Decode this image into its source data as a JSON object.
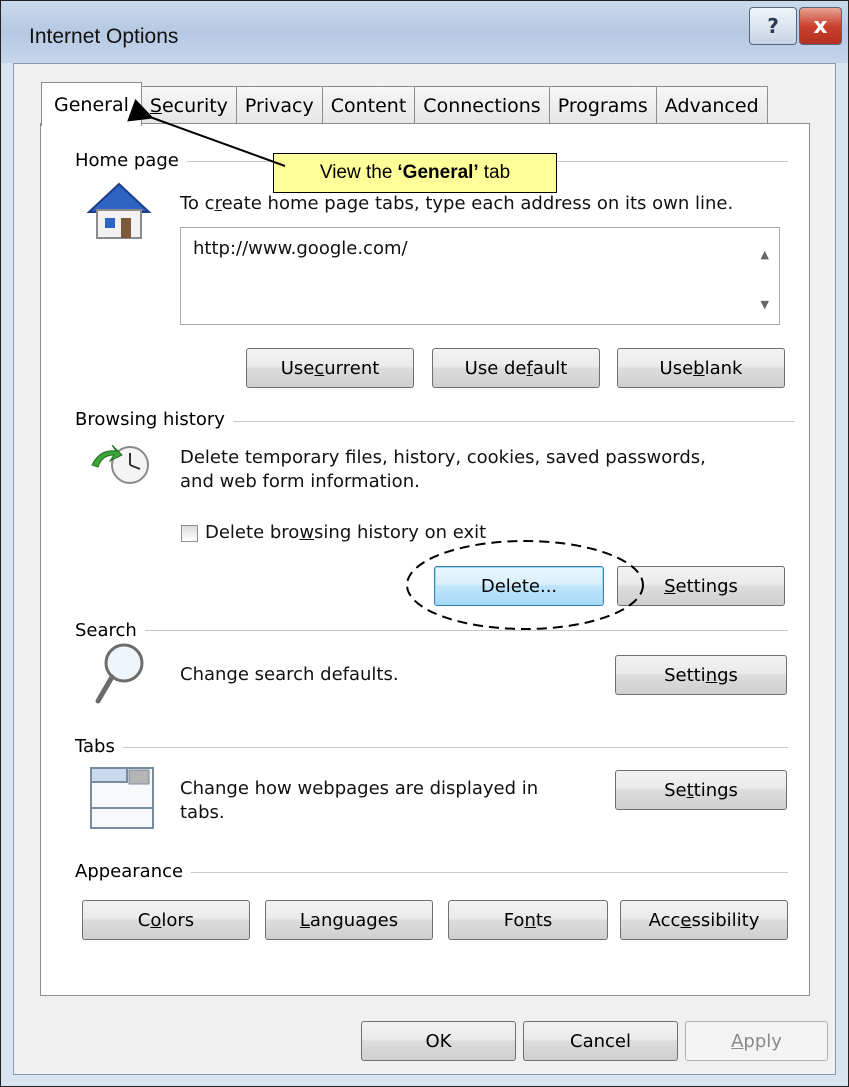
{
  "window": {
    "title": "Internet Options",
    "help_glyph": "?",
    "close_glyph": "x"
  },
  "tabs": [
    {
      "pre": "General",
      "u": "",
      "post": ""
    },
    {
      "pre": "",
      "u": "S",
      "post": "ecurity"
    },
    {
      "pre": "Privacy",
      "u": "",
      "post": ""
    },
    {
      "pre": "Content",
      "u": "",
      "post": ""
    },
    {
      "pre": "Connections",
      "u": "",
      "post": ""
    },
    {
      "pre": "Programs",
      "u": "",
      "post": ""
    },
    {
      "pre": "Advanced",
      "u": "",
      "post": ""
    }
  ],
  "home_page": {
    "label": "Home page",
    "desc_pre": "To c",
    "desc_u": "r",
    "desc_post": "eate home page tabs, type each address on its own line.",
    "url": "http://www.google.com/",
    "btn_current": {
      "pre": "Use ",
      "u": "c",
      "post": "urrent"
    },
    "btn_default": {
      "pre": "Use de",
      "u": "f",
      "post": "ault"
    },
    "btn_blank": {
      "pre": "Use ",
      "u": "b",
      "post": "lank"
    }
  },
  "browsing_history": {
    "label": "Browsing history",
    "desc_line1": "Delete temporary files, history, cookies, saved passwords,",
    "desc_line2": "and web form information.",
    "checkbox": {
      "pre": "Delete bro",
      "u": "w",
      "post": "sing history on exit",
      "checked": false
    },
    "btn_delete": "Delete...",
    "btn_settings": {
      "pre": "",
      "u": "S",
      "post": "ettings"
    }
  },
  "search": {
    "label": "Search",
    "desc": "Change search defaults.",
    "btn_settings": {
      "pre": "Setti",
      "u": "n",
      "post": "gs"
    }
  },
  "tabs_group": {
    "label": "Tabs",
    "desc_line1": "Change how webpages are displayed in",
    "desc_line2": "tabs.",
    "btn_settings": {
      "pre": "Se",
      "u": "t",
      "post": "tings"
    }
  },
  "appearance": {
    "label": "Appearance",
    "btn_colors": {
      "pre": "C",
      "u": "o",
      "post": "lors"
    },
    "btn_languages": {
      "pre": "",
      "u": "L",
      "post": "anguages"
    },
    "btn_fonts": {
      "pre": "Fo",
      "u": "n",
      "post": "ts"
    },
    "btn_accessibility": {
      "pre": "Acc",
      "u": "e",
      "post": "ssibility"
    }
  },
  "footer": {
    "ok": "OK",
    "cancel": "Cancel",
    "apply_u": "A",
    "apply_post": "pply"
  },
  "callout": {
    "pre": "View the ",
    "bold": "‘General’",
    "post": " tab"
  },
  "colors": {
    "callout_bg": "#ffff99",
    "titlebar": "#c5d6ec",
    "close": "#c8422e",
    "default_btn": "#bee6fd"
  }
}
